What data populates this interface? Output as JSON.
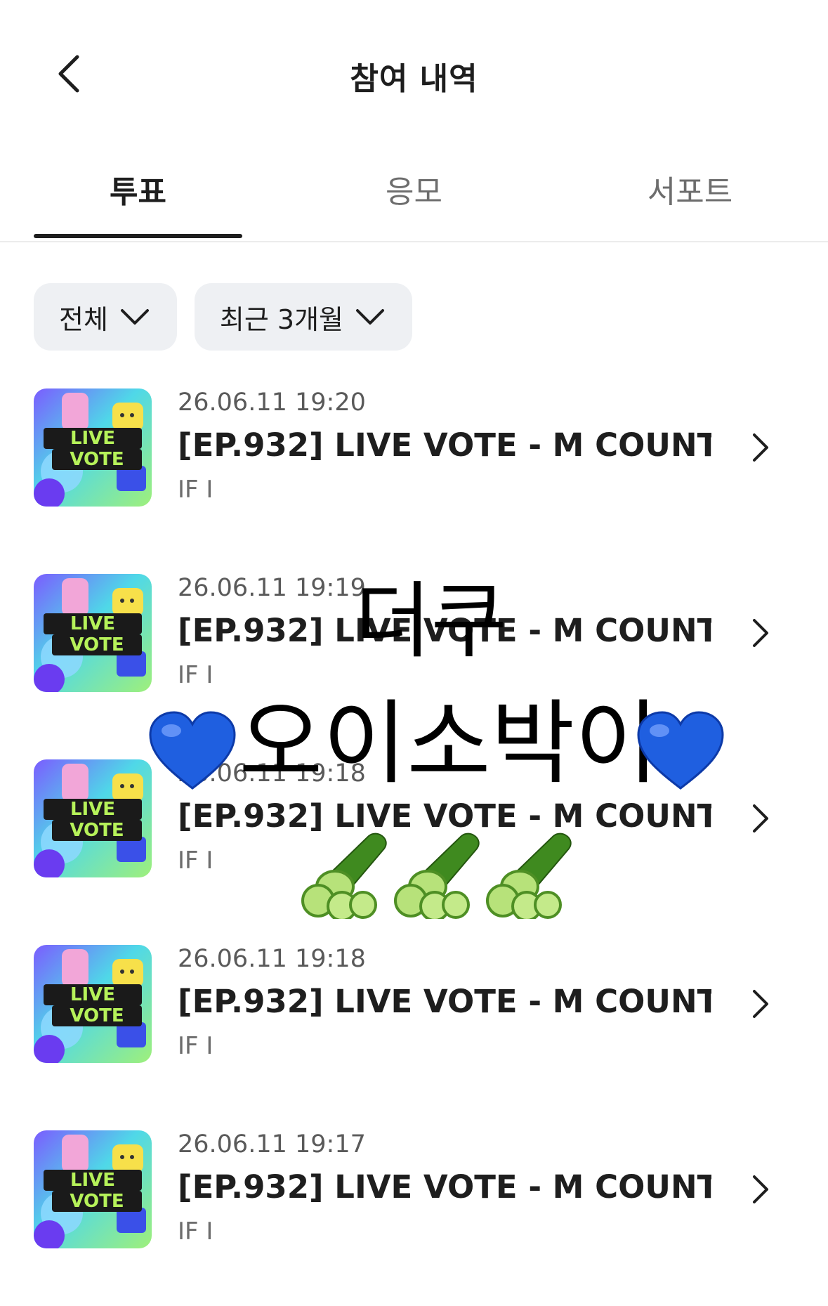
{
  "header": {
    "back_icon": "chevron-left-icon",
    "title": "참여 내역"
  },
  "tabs": [
    {
      "label": "투표",
      "active": true
    },
    {
      "label": "응모",
      "active": false
    },
    {
      "label": "서포트",
      "active": false
    }
  ],
  "filters": [
    {
      "label": "전체",
      "icon": "chevron-down-icon"
    },
    {
      "label": "최근 3개월",
      "icon": "chevron-down-icon"
    }
  ],
  "items": [
    {
      "date": "26.06.11 19:20",
      "title": "[EP.932] LIVE VOTE - M COUNT...",
      "subtitle": "IF I",
      "thumb": {
        "line1": "LIVE",
        "line2": "VOTE"
      }
    },
    {
      "date": "26.06.11 19:19",
      "title": "[EP.932] LIVE VOTE - M COUNT...",
      "subtitle": "IF I",
      "thumb": {
        "line1": "LIVE",
        "line2": "VOTE"
      }
    },
    {
      "date": "26.06.11 19:18",
      "title": "[EP.932] LIVE VOTE - M COUNT...",
      "subtitle": "IF I",
      "thumb": {
        "line1": "LIVE",
        "line2": "VOTE"
      }
    },
    {
      "date": "26.06.11 19:18",
      "title": "[EP.932] LIVE VOTE - M COUNT...",
      "subtitle": "IF I",
      "thumb": {
        "line1": "LIVE",
        "line2": "VOTE"
      }
    },
    {
      "date": "26.06.11 19:17",
      "title": "[EP.932] LIVE VOTE - M COUNT...",
      "subtitle": "IF I",
      "thumb": {
        "line1": "LIVE",
        "line2": "VOTE"
      }
    }
  ],
  "overlay": {
    "line1": "더쿠",
    "line2": "오이소박이",
    "heart_color": "#1f5fe0",
    "emoji": [
      "blue-heart-icon",
      "cucumber-icon"
    ]
  }
}
